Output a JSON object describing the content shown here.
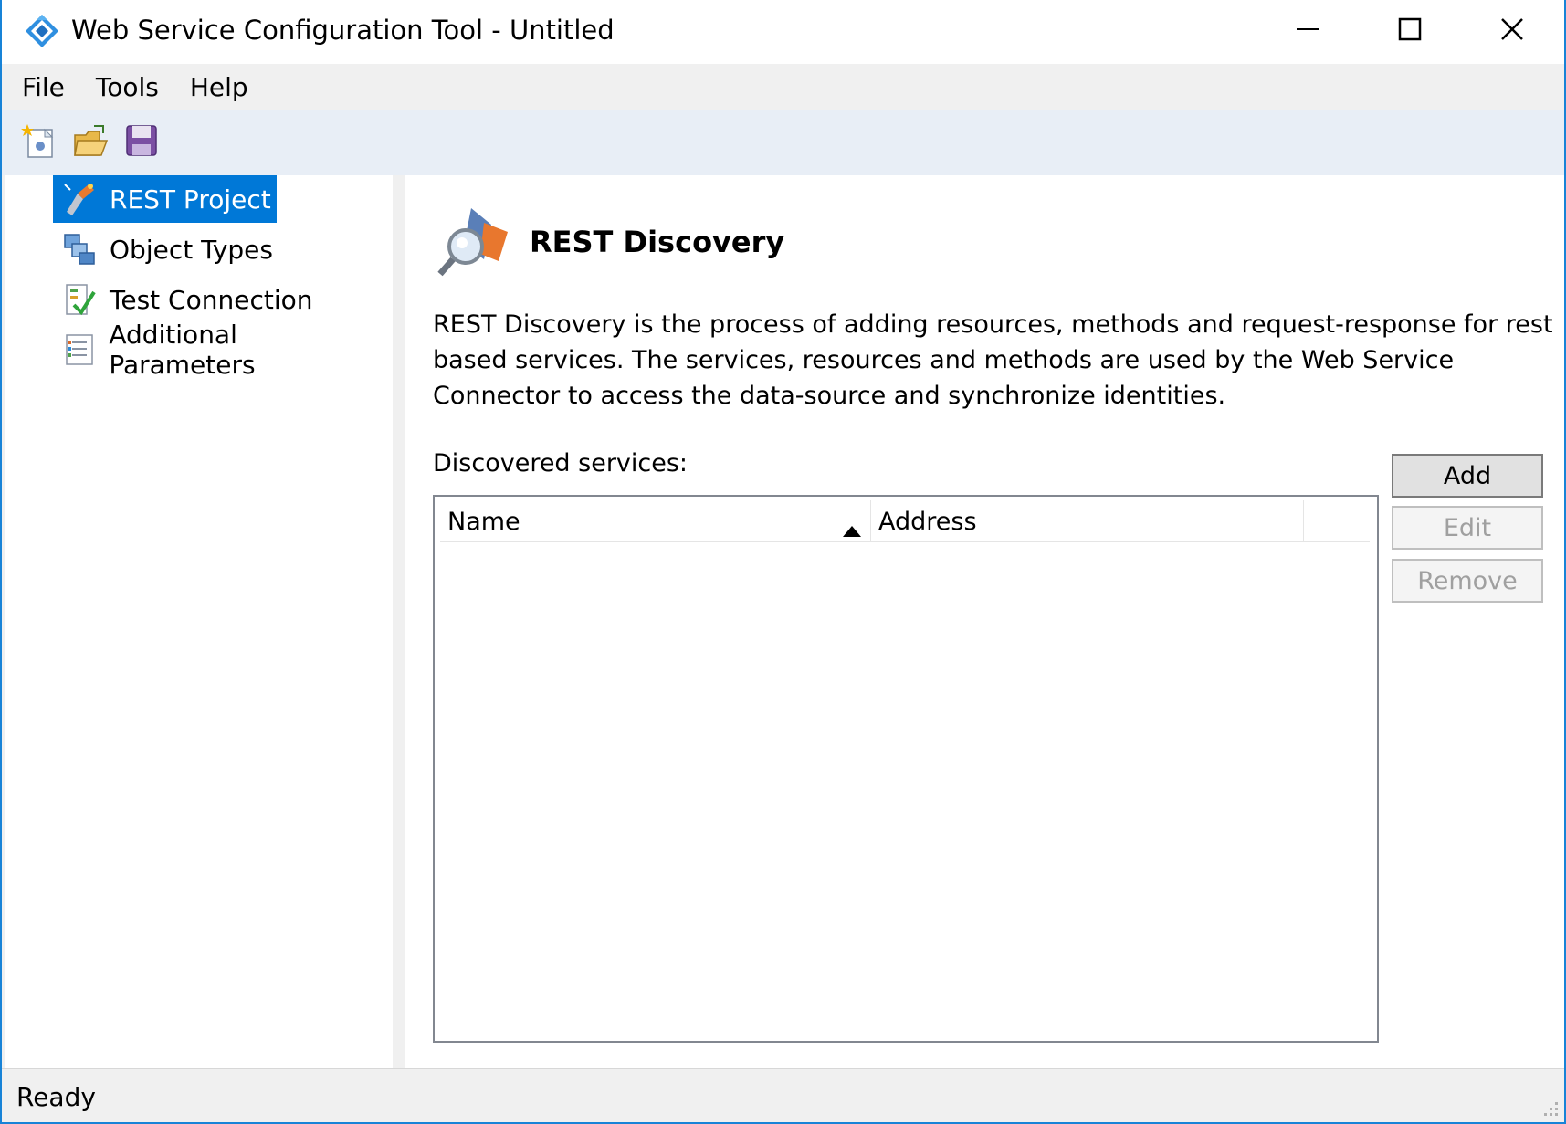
{
  "window": {
    "title": "Web Service Configuration Tool - Untitled",
    "app_icon": "diamond-arrows-icon",
    "controls": [
      "minimize-icon",
      "maximize-icon",
      "close-icon"
    ]
  },
  "menu": {
    "items": [
      {
        "label": "File"
      },
      {
        "label": "Tools"
      },
      {
        "label": "Help"
      }
    ]
  },
  "toolbar": {
    "buttons": [
      {
        "icon": "new-project-icon"
      },
      {
        "icon": "open-folder-icon"
      },
      {
        "icon": "save-disk-icon"
      }
    ]
  },
  "nav": {
    "items": [
      {
        "label": "REST Project",
        "icon": "rest-project-icon",
        "selected": true
      },
      {
        "label": "Object Types",
        "icon": "object-types-icon",
        "selected": false
      },
      {
        "label": "Test Connection",
        "icon": "test-connection-icon",
        "selected": false
      },
      {
        "label": "Additional Parameters",
        "icon": "additional-parameters-icon",
        "selected": false
      }
    ]
  },
  "content": {
    "icon": "rest-discovery-icon",
    "title": "REST Discovery",
    "description": "REST Discovery is the process of adding resources, methods and request-response for rest based services. The services, resources and methods are used by the Web Service Connector to access the data-source and synchronize identities.",
    "list_label": "Discovered services:",
    "columns": [
      {
        "label": "Name",
        "sort": "ascending"
      },
      {
        "label": "Address"
      }
    ],
    "rows": [],
    "buttons": {
      "add": "Add",
      "edit": "Edit",
      "remove": "Remove"
    }
  },
  "status": {
    "text": "Ready"
  },
  "colors": {
    "accent": "#0078d7",
    "window_border": "#1883d7",
    "toolbar_bg": "#e8eef6"
  }
}
